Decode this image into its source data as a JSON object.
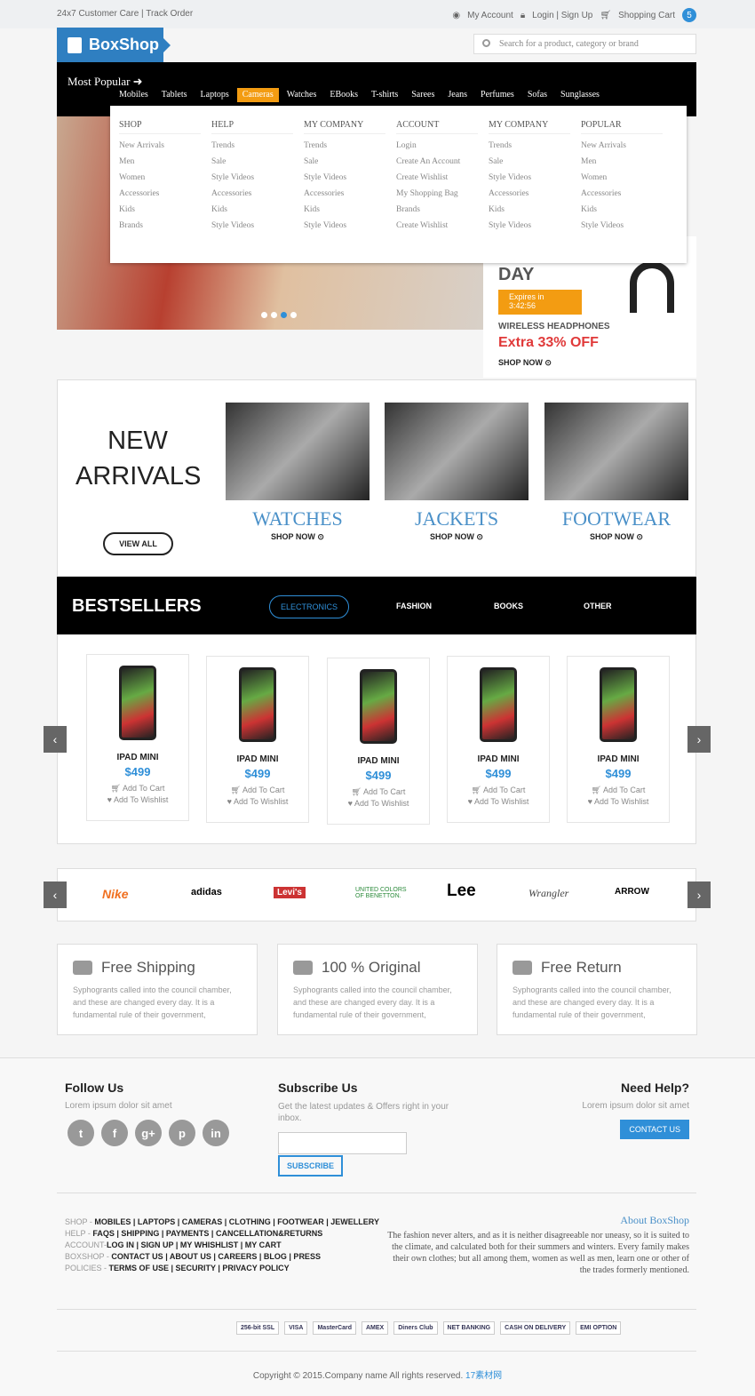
{
  "topbar": {
    "left": "24x7 Customer Care | Track Order",
    "account": "My Account",
    "login": "Login | Sign Up",
    "cart": "Shopping Cart",
    "cart_count": "5"
  },
  "logo": "BoxShop",
  "search": {
    "placeholder": "Search for a product, category or brand"
  },
  "nav": {
    "most_popular": "Most Popular",
    "items": [
      "Mobiles",
      "Tablets",
      "Laptops",
      "Cameras",
      "Watches",
      "EBooks",
      "T-shirts",
      "Sarees",
      "Jeans",
      "Perfumes",
      "Sofas",
      "Sunglasses"
    ],
    "active": "Cameras"
  },
  "mega": [
    {
      "title": "SHOP",
      "links": [
        "New Arrivals",
        "Men",
        "Women",
        "Accessories",
        "Kids",
        "Brands"
      ]
    },
    {
      "title": "HELP",
      "links": [
        "Trends",
        "Sale",
        "Style Videos",
        "Accessories",
        "Kids",
        "Style Videos"
      ]
    },
    {
      "title": "MY COMPANY",
      "links": [
        "Trends",
        "Sale",
        "Style Videos",
        "Accessories",
        "Kids",
        "Style Videos"
      ]
    },
    {
      "title": "ACCOUNT",
      "links": [
        "Login",
        "Create An Account",
        "Create Wishlist",
        "My Shopping Bag",
        "Brands",
        "Create Wishlist"
      ]
    },
    {
      "title": "MY COMPANY",
      "links": [
        "Trends",
        "Sale",
        "Style Videos",
        "Accessories",
        "Kids",
        "Style Videos"
      ]
    },
    {
      "title": "POPULAR",
      "links": [
        "New Arrivals",
        "Men",
        "Women",
        "Accessories",
        "Kids",
        "Style Videos"
      ]
    }
  ],
  "deal": {
    "day": "DAY",
    "expires": "Expires in",
    "time": "3:42:56",
    "product": "WIRELESS HEADPHONES",
    "offer": "Extra 33% OFF",
    "shop_now": "SHOP NOW"
  },
  "new_arrivals": {
    "title_line1": "NEW",
    "title_line2": "ARRIVALS",
    "view_all": "VIEW ALL",
    "categories": [
      {
        "name": "WATCHES",
        "cta": "SHOP NOW"
      },
      {
        "name": "JACKETS",
        "cta": "SHOP NOW"
      },
      {
        "name": "FOOTWEAR",
        "cta": "SHOP NOW"
      }
    ]
  },
  "bestsellers": {
    "title": "BESTSELLERS",
    "tabs": [
      "ELECTRONICS",
      "FASHION",
      "BOOKS",
      "OTHER"
    ],
    "active_tab": "ELECTRONICS",
    "products": [
      {
        "name": "IPAD MINI",
        "price": "$499"
      },
      {
        "name": "IPAD MINI",
        "price": "$499"
      },
      {
        "name": "IPAD MINI",
        "price": "$499"
      },
      {
        "name": "IPAD MINI",
        "price": "$499"
      },
      {
        "name": "IPAD MINI",
        "price": "$499"
      }
    ],
    "add_to_cart": "Add To Cart",
    "add_to_wishlist": "Add To Wishlist"
  },
  "brands": [
    "Nike",
    "adidas",
    "Levi's",
    "UNITED COLORS OF BENETTON.",
    "Lee",
    "Wrangler",
    "ARROW"
  ],
  "features": [
    {
      "title": "Free Shipping",
      "icon": "truck-icon",
      "text": "Syphogrants called into the council chamber, and these are changed every day. It is a fundamental rule of their government,"
    },
    {
      "title": "100 % Original",
      "icon": "check-circle-icon",
      "text": "Syphogrants called into the council chamber, and these are changed every day. It is a fundamental rule of their government,"
    },
    {
      "title": "Free Return",
      "icon": "return-bag-icon",
      "text": "Syphogrants called into the council chamber, and these are changed every day. It is a fundamental rule of their government,"
    }
  ],
  "footer": {
    "follow": {
      "title": "Follow Us",
      "text": "Lorem ipsum dolor sit amet",
      "social": [
        "t",
        "f",
        "g+",
        "p",
        "in"
      ]
    },
    "subscribe": {
      "title": "Subscribe Us",
      "text": "Get the latest updates & Offers right in your inbox.",
      "button": "SUBSCRIBE"
    },
    "help": {
      "title": "Need Help?",
      "text": "Lorem ipsum dolor sit amet",
      "button": "CONTACT US"
    },
    "link_rows": [
      {
        "label": "SHOP - ",
        "links": "MOBILES | LAPTOPS | CAMERAS | CLOTHING | FOOTWEAR | JEWELLERY"
      },
      {
        "label": "HELP - ",
        "links": "FAQS | SHIPPING | PAYMENTS | CANCELLATION&RETURNS"
      },
      {
        "label": "ACCOUNT-",
        "links": "LOG IN | SIGN UP | MY WHISHLIST | MY CART"
      },
      {
        "label": "BOXSHOP - ",
        "links": "CONTACT US | ABOUT US | CAREERS | BLOG | PRESS"
      },
      {
        "label": "POLICIES - ",
        "links": "TERMS OF USE | SECURITY | PRIVACY POLICY"
      }
    ],
    "about": {
      "title": "About BoxShop",
      "text": "The fashion never alters, and as it is neither disagreeable nor uneasy, so it is suited to the climate, and calculated both for their summers and winters. Every family makes their own clothes; but all among them, women as well as men, learn one or other of the trades formerly mentioned."
    },
    "payments": [
      "256-bit SSL",
      "VISA",
      "MasterCard",
      "AMEX",
      "Diners Club",
      "NET BANKING",
      "CASH ON DELIVERY",
      "EMI OPTION"
    ],
    "copyright": "Copyright © 2015.Company name All rights reserved.",
    "copyright_link": "17素材网"
  }
}
